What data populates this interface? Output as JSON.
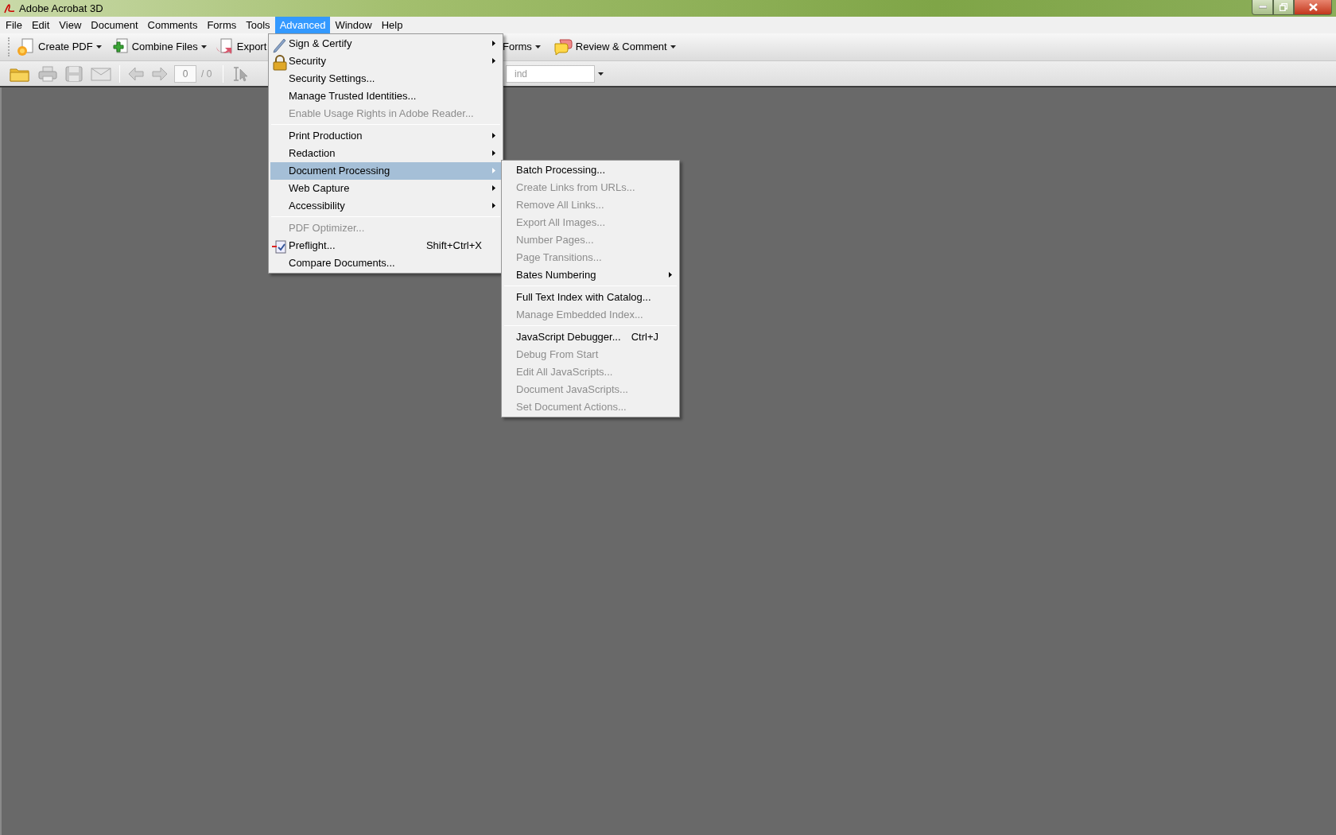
{
  "window": {
    "title": "Adobe Acrobat 3D"
  },
  "menu_bar": [
    {
      "label": "File",
      "selected": false
    },
    {
      "label": "Edit",
      "selected": false
    },
    {
      "label": "View",
      "selected": false
    },
    {
      "label": "Document",
      "selected": false
    },
    {
      "label": "Comments",
      "selected": false
    },
    {
      "label": "Forms",
      "selected": false
    },
    {
      "label": "Tools",
      "selected": false
    },
    {
      "label": "Advanced",
      "selected": true
    },
    {
      "label": "Window",
      "selected": false
    },
    {
      "label": "Help",
      "selected": false
    }
  ],
  "task_toolbar": {
    "left_buttons": [
      {
        "label": "Create PDF"
      },
      {
        "label": "Combine Files"
      },
      {
        "label": "Export"
      }
    ],
    "right_buttons": [
      {
        "label": "Forms"
      },
      {
        "label": "Review & Comment"
      }
    ]
  },
  "file_toolbar": {
    "page_number": "0",
    "page_count": "/ 0",
    "find": {
      "placeholder": "ind"
    }
  },
  "advanced_menu": {
    "items": [
      {
        "kind": "item",
        "label": "Sign & Certify",
        "submenu": true,
        "disabled": false,
        "selected": false
      },
      {
        "kind": "item",
        "label": "Security",
        "submenu": true,
        "disabled": false,
        "selected": false
      },
      {
        "kind": "item",
        "label": "Security Settings...",
        "submenu": false,
        "disabled": false,
        "selected": false
      },
      {
        "kind": "item",
        "label": "Manage Trusted Identities...",
        "submenu": false,
        "disabled": false,
        "selected": false
      },
      {
        "kind": "item",
        "label": "Enable Usage Rights in Adobe Reader...",
        "submenu": false,
        "disabled": true,
        "selected": false
      },
      {
        "kind": "separator"
      },
      {
        "kind": "item",
        "label": "Print Production",
        "submenu": true,
        "disabled": false,
        "selected": false
      },
      {
        "kind": "item",
        "label": "Redaction",
        "submenu": true,
        "disabled": false,
        "selected": false
      },
      {
        "kind": "item",
        "label": "Document Processing",
        "submenu": true,
        "disabled": false,
        "selected": true
      },
      {
        "kind": "item",
        "label": "Web Capture",
        "submenu": true,
        "disabled": false,
        "selected": false
      },
      {
        "kind": "item",
        "label": "Accessibility",
        "submenu": true,
        "disabled": false,
        "selected": false
      },
      {
        "kind": "separator"
      },
      {
        "kind": "item",
        "label": "PDF Optimizer...",
        "submenu": false,
        "disabled": true,
        "selected": false
      },
      {
        "kind": "item",
        "label": "Preflight...",
        "shortcut": "Shift+Ctrl+X",
        "submenu": false,
        "disabled": false,
        "selected": false
      },
      {
        "kind": "item",
        "label": "Compare Documents...",
        "submenu": false,
        "disabled": false,
        "selected": false
      }
    ]
  },
  "document_processing_menu": {
    "items": [
      {
        "kind": "item",
        "label": "Batch Processing...",
        "submenu": false,
        "disabled": false,
        "selected": false
      },
      {
        "kind": "item",
        "label": "Create Links from URLs...",
        "submenu": false,
        "disabled": true,
        "selected": false
      },
      {
        "kind": "item",
        "label": "Remove All Links...",
        "submenu": false,
        "disabled": true,
        "selected": false
      },
      {
        "kind": "item",
        "label": "Export All Images...",
        "submenu": false,
        "disabled": true,
        "selected": false
      },
      {
        "kind": "item",
        "label": "Number Pages...",
        "submenu": false,
        "disabled": true,
        "selected": false
      },
      {
        "kind": "item",
        "label": "Page Transitions...",
        "submenu": false,
        "disabled": true,
        "selected": false
      },
      {
        "kind": "item",
        "label": "Bates Numbering",
        "submenu": true,
        "disabled": false,
        "selected": false
      },
      {
        "kind": "separator"
      },
      {
        "kind": "item",
        "label": "Full Text Index with Catalog...",
        "submenu": false,
        "disabled": false,
        "selected": false
      },
      {
        "kind": "item",
        "label": "Manage Embedded Index...",
        "submenu": false,
        "disabled": true,
        "selected": false
      },
      {
        "kind": "separator"
      },
      {
        "kind": "item",
        "label": "JavaScript Debugger...",
        "shortcut": "Ctrl+J",
        "submenu": false,
        "disabled": false,
        "selected": false
      },
      {
        "kind": "item",
        "label": "Debug From Start",
        "submenu": false,
        "disabled": true,
        "selected": false
      },
      {
        "kind": "item",
        "label": "Edit All JavaScripts...",
        "submenu": false,
        "disabled": true,
        "selected": false
      },
      {
        "kind": "item",
        "label": "Document JavaScripts...",
        "submenu": false,
        "disabled": true,
        "selected": false
      },
      {
        "kind": "item",
        "label": "Set Document Actions...",
        "submenu": false,
        "disabled": true,
        "selected": false
      }
    ]
  }
}
